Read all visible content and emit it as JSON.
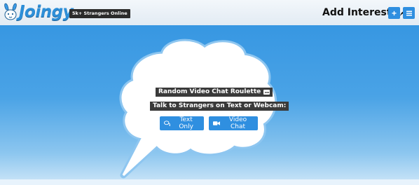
{
  "header": {
    "logo_text": "Joingy",
    "online_badge": "5k+ Strangers Online",
    "add_interests_label": "Add Interests",
    "arrow_icon": "share-arrow-icon",
    "plus_button_label": "+",
    "menu_icon": "hamburger-menu-icon"
  },
  "main": {
    "title_line": "Random Video Chat Roulette",
    "subtitle_line": "Talk to Strangers on Text or Webcam:",
    "chat_icon": "speech-bubble-icon",
    "buttons": {
      "text_only": {
        "label": "Text Only",
        "icon": "comments-icon"
      },
      "video_chat": {
        "label": "Video Chat",
        "icon": "video-camera-icon"
      }
    }
  },
  "colors": {
    "brand_blue": "#2f8fe0",
    "background_top": "#3797e2",
    "background_bottom": "#cfe7f8",
    "cloud_fill": "#ffffff",
    "cloud_outline": "#8ec6f0",
    "label_bg": "#3a3a3a"
  }
}
